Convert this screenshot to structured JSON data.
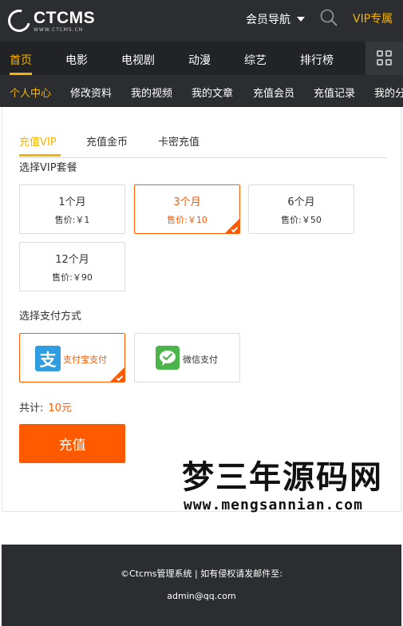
{
  "header": {
    "logo_text": "CTCMS",
    "logo_sub": "WWW.CTCMS.CN",
    "member_nav": "会员导航",
    "vip_link": "VIP专属"
  },
  "main_nav": {
    "items": [
      {
        "label": "首页"
      },
      {
        "label": "电影"
      },
      {
        "label": "电视剧"
      },
      {
        "label": "动漫"
      },
      {
        "label": "综艺"
      },
      {
        "label": "排行榜"
      }
    ]
  },
  "sub_nav": {
    "items": [
      {
        "label": "个人中心"
      },
      {
        "label": "修改资料"
      },
      {
        "label": "我的视频"
      },
      {
        "label": "我的文章"
      },
      {
        "label": "充值会员"
      },
      {
        "label": "充值记录"
      },
      {
        "label": "我的分"
      }
    ]
  },
  "tabs": [
    {
      "label": "充值VIP"
    },
    {
      "label": "充值金币"
    },
    {
      "label": "卡密充值"
    }
  ],
  "vip_section": {
    "label": "选择VIP套餐",
    "options": [
      {
        "name": "1个月",
        "price": "售价:￥1"
      },
      {
        "name": "3个月",
        "price": "售价:￥10"
      },
      {
        "name": "6个月",
        "price": "售价:￥50"
      },
      {
        "name": "12个月",
        "price": "售价:￥90"
      }
    ],
    "selected_index": 1
  },
  "pay_section": {
    "label": "选择支付方式",
    "methods": [
      {
        "name": "支付宝支付",
        "icon": "alipay-icon",
        "icon_char": "支"
      },
      {
        "name": "微信支付",
        "icon": "wechat-icon"
      }
    ],
    "selected_index": 0
  },
  "total": {
    "label": "共计:",
    "amount": "10元"
  },
  "submit_label": "充值",
  "watermark": {
    "title": "梦三年源码网",
    "url": "www.mengsannian.com"
  },
  "footer": {
    "line1": "©Ctcms管理系统 | 如有侵权请发邮件至:",
    "line2": "admin@qq.com"
  },
  "colors": {
    "accent": "#f6b400",
    "primary": "#ff5a00",
    "header_bg": "#2b2d30",
    "alipay": "#2f9ee0",
    "wechat": "#4bb44a"
  }
}
